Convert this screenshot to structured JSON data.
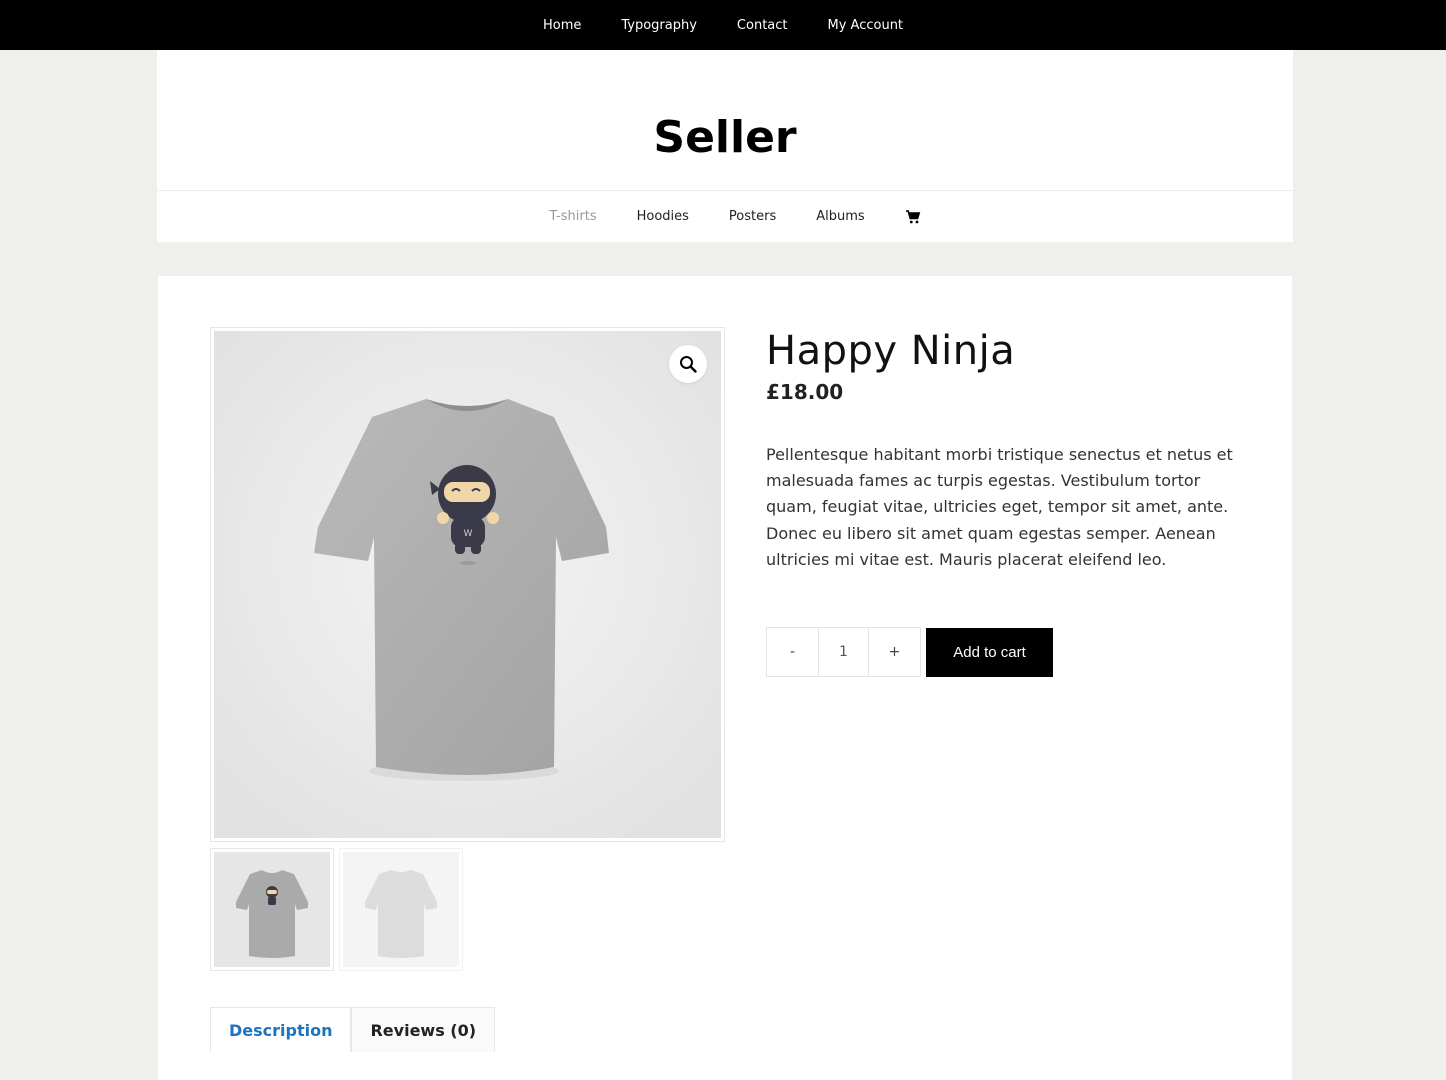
{
  "top_nav": [
    "Home",
    "Typography",
    "Contact",
    "My Account"
  ],
  "site": {
    "title": "Seller"
  },
  "category_nav": {
    "items": [
      "T-shirts",
      "Hoodies",
      "Posters",
      "Albums"
    ],
    "active": "T-shirts"
  },
  "product": {
    "title": "Happy Ninja",
    "price": "£18.00",
    "description": "Pellentesque habitant morbi tristique senectus et netus et malesuada fames ac turpis egestas. Vestibulum tortor quam, feugiat vitae, ultricies eget, tempor sit amet, ante. Donec eu libero sit amet quam egestas semper. Aenean ultricies mi vitae est. Mauris placerat eleifend leo.",
    "quantity": {
      "minus": "-",
      "value": "1",
      "plus": "+"
    },
    "add_to_cart": "Add to cart"
  },
  "tabs": [
    "Description",
    "Reviews (0)"
  ],
  "colors": {
    "topbar": "#000000",
    "active_tab": "#1e73be",
    "button": "#000000"
  },
  "icons": {
    "zoom": "magnifier-icon",
    "cart": "shopping-cart-icon"
  }
}
